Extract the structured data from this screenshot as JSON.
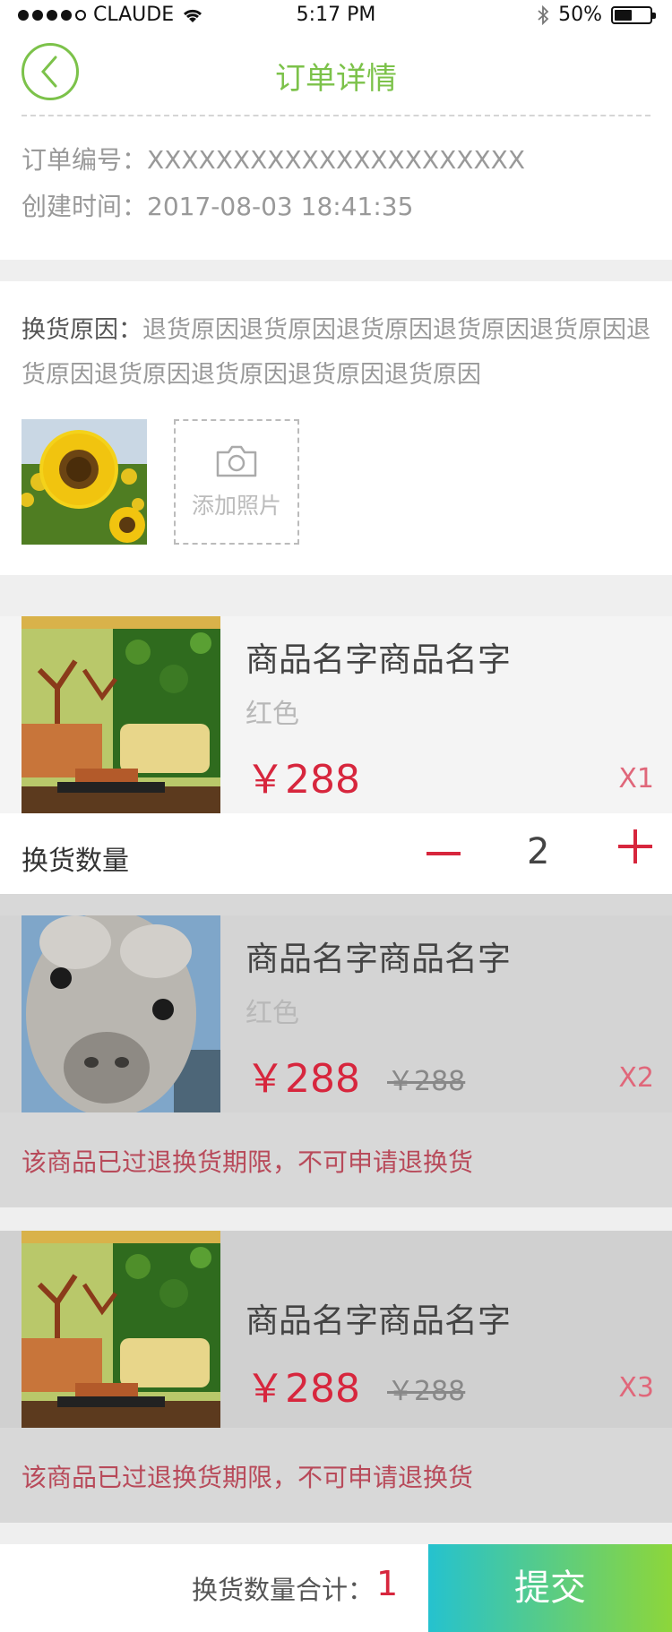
{
  "status_bar": {
    "carrier": "CLAUDE",
    "time": "5:17 PM",
    "battery": "50%",
    "battery_level": 0.5
  },
  "header": {
    "title": "订单详情",
    "back_icon": "chevron-left-icon"
  },
  "order": {
    "number_label": "订单编号：",
    "number_value": "XXXXXXXXXXXXXXXXXXXXXX",
    "created_label": "创建时间：",
    "created_value": "2017-08-03 18:41:35"
  },
  "reason": {
    "label": "换货原因：",
    "text": "退货原因退货原因退货原因退货原因退货原因退货原因退货原因退货原因退货原因退货原因",
    "add_photo_label": "添加照片",
    "add_photo_icon": "camera-icon",
    "photos": [
      "sunflower"
    ]
  },
  "items": [
    {
      "name": "商品名字商品名字",
      "color": "红色",
      "price": "￥288",
      "qty": "X1",
      "image": "living-room"
    },
    {
      "name": "商品名字商品名字",
      "color": "红色",
      "price": "￥288",
      "old_price": "￥288",
      "qty": "X2",
      "image": "alpaca",
      "note": "该商品已过退换货期限，不可申请退换货"
    },
    {
      "name": "商品名字商品名字",
      "price": "￥288",
      "old_price": "￥288",
      "qty": "X3",
      "image": "living-room",
      "note": "该商品已过退换货期限，不可申请退换货"
    }
  ],
  "exchange": {
    "label": "换货数量",
    "value": "2"
  },
  "footer": {
    "total_label": "换货数量合计：",
    "total_value": "1",
    "submit_label": "提交"
  },
  "colors": {
    "accent_green": "#7cc24a",
    "price_red": "#d7263d",
    "submit_gradient": [
      "#25c2cf",
      "#8dd63a"
    ]
  }
}
